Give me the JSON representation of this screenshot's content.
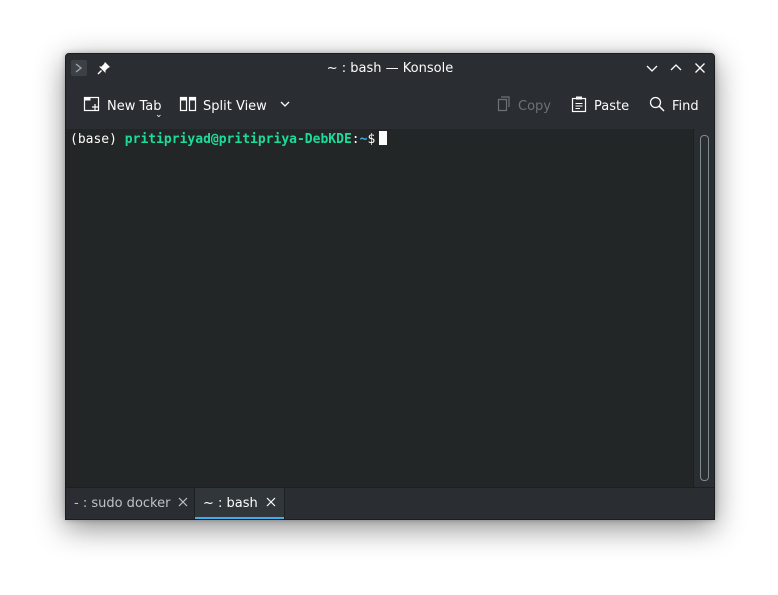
{
  "window": {
    "title": "~ : bash — Konsole"
  },
  "toolbar": {
    "new_tab_label": "New Tab",
    "split_view_label": "Split View",
    "copy_label": "Copy",
    "paste_label": "Paste",
    "find_label": "Find"
  },
  "terminal": {
    "env": "(base)",
    "user_host": "pritipriyad@pritipriya-DebKDE",
    "colon": ":",
    "path": "~",
    "symbol": "$"
  },
  "tabs": [
    {
      "label": "- : sudo docker",
      "active": false
    },
    {
      "label": "~ : bash",
      "active": true
    }
  ],
  "colors": {
    "accent": "#3daee9",
    "prompt_green": "#1cdc9a",
    "background": "#232627"
  },
  "icons": [
    "konsole-app-icon",
    "pin-icon",
    "minimize-icon",
    "maximize-icon",
    "close-icon",
    "new-tab-icon",
    "split-view-icon",
    "chevron-down-icon",
    "copy-icon",
    "paste-icon",
    "search-icon",
    "tab-close-icon"
  ]
}
